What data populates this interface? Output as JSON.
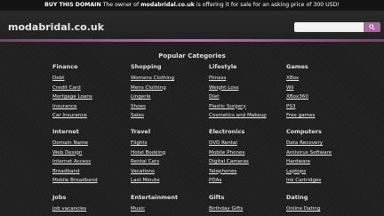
{
  "banner": {
    "prefix": "BUY THIS DOMAIN",
    "text_a": " The owner of ",
    "domain": "modabridal.co.uk",
    "text_b": " is offering it for sale for an asking price of 300 USD!"
  },
  "header": {
    "logo": "modabridal.co.uk",
    "search_placeholder": "",
    "search_icon": "search-icon"
  },
  "popular": {
    "title": "Popular Categories"
  },
  "categories": [
    {
      "title": "Finance",
      "links": [
        "Debt",
        "Credit Card",
        "Mortgage Loans",
        "Insurance",
        "Car Insurance"
      ]
    },
    {
      "title": "Shopping",
      "links": [
        "Womens Clothing",
        "Mens Clothing",
        "Lingerie",
        "Shoes",
        "Sales"
      ]
    },
    {
      "title": "Lifestyle",
      "links": [
        "Fitness",
        "Weight Loss",
        "Diet",
        "Plastic Surgery",
        "Cosmetics and Makeup"
      ]
    },
    {
      "title": "Games",
      "links": [
        "XBox",
        "Wii",
        "XBox360",
        "PS3",
        "Free games"
      ]
    },
    {
      "title": "Internet",
      "links": [
        "Domain Name",
        "Web Design",
        "Internet Access",
        "Broadband",
        "Mobile Broadband"
      ]
    },
    {
      "title": "Travel",
      "links": [
        "Flights",
        "Hotel Booking",
        "Rental Cars",
        "Vacations",
        "Last Minute"
      ]
    },
    {
      "title": "Electronics",
      "links": [
        "DVD Rental",
        "Mobile Phones",
        "Digital Cameras",
        "Telephones",
        "PDAs"
      ]
    },
    {
      "title": "Computers",
      "links": [
        "Data Recovery",
        "Antivirus Software",
        "Hardware",
        "Laptops",
        "Ink Cartridges"
      ]
    },
    {
      "title": "Jobs",
      "links": [
        "Job vacancies"
      ]
    },
    {
      "title": "Entertainment",
      "links": [
        "Music"
      ]
    },
    {
      "title": "Gifts",
      "links": [
        "Birthday Gifts"
      ]
    },
    {
      "title": "Dating",
      "links": [
        "Online Dating"
      ]
    }
  ]
}
